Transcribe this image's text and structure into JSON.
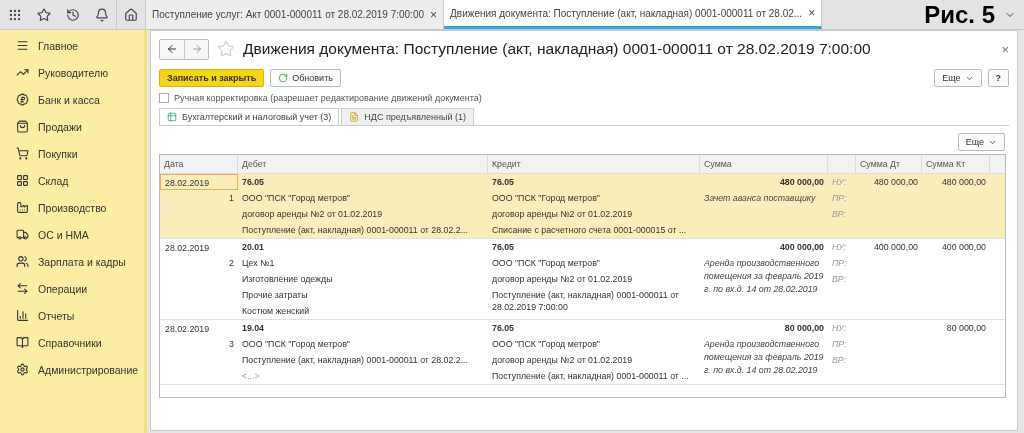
{
  "top_bar": {
    "tabs": [
      {
        "label": "Поступление услуг: Акт 0001-000011 от 28.02.2019 7:00:00",
        "close": "×",
        "selected": false
      },
      {
        "label": "Движения документа: Поступление (акт, накладная) 0001-000011 от 28.02...",
        "close": "×",
        "selected": true
      }
    ],
    "figure_label": "Рис. 5"
  },
  "sidebar": {
    "items": [
      {
        "label": "Главное"
      },
      {
        "label": "Руководителю"
      },
      {
        "label": "Банк и касса"
      },
      {
        "label": "Продажи"
      },
      {
        "label": "Покупки"
      },
      {
        "label": "Склад"
      },
      {
        "label": "Производство"
      },
      {
        "label": "ОС и НМА"
      },
      {
        "label": "Зарплата и кадры"
      },
      {
        "label": "Операции"
      },
      {
        "label": "Отчеты"
      },
      {
        "label": "Справочники"
      },
      {
        "label": "Администрирование"
      }
    ]
  },
  "document": {
    "title": "Движения документа: Поступление (акт, накладная) 0001-000011 от 28.02.2019 7:00:00",
    "close": "×",
    "save_button": "Записать и закрыть",
    "refresh_button": "Обновить",
    "more_button": "Еще",
    "help_button": "?",
    "manual_edit": {
      "label": "Ручная корректировка (разрешает редактирование движений документа)",
      "checked": false
    },
    "tabs": [
      {
        "label": "Бухгалтерский и налоговый учет (3)",
        "selected": true
      },
      {
        "label": "НДС предъявленный (1)",
        "selected": false
      }
    ],
    "table": {
      "more_button": "Еще",
      "columns": [
        "Дата",
        "Дебет",
        "Кредит",
        "Сумма",
        "Сумма Дт",
        "Сумма Кт"
      ],
      "rows": [
        {
          "selected": true,
          "date": "28.02.2019",
          "number": "1",
          "debit": [
            "76.05",
            "ООО \"ПСК \"Город метров\"",
            "договор аренды №2 от 01.02.2019",
            "Поступление (акт, накладная) 0001-000011 от 28.02.2..."
          ],
          "credit": [
            "76.05",
            "ООО \"ПСК \"Город метров\"",
            "договор аренды №2 от 01.02.2019",
            "Списание с расчетного счета 0001-000015 от ..."
          ],
          "sum": "480 000,00",
          "comment": "Зачет аванса поставщику",
          "tax_labels": [
            "НУ:",
            "ПР:",
            "ВР:"
          ],
          "sum_dt": "480 000,00",
          "sum_kt": "480 000,00"
        },
        {
          "selected": false,
          "date": "28.02.2019",
          "number": "2",
          "debit": [
            "20.01",
            "Цех №1",
            "Изготовление одежды",
            "Прочие затраты",
            "Костюм женский"
          ],
          "credit": [
            "76.05",
            "ООО \"ПСК \"Город метров\"",
            "договор аренды №2 от 01.02.2019",
            "Поступление (акт, накладная) 0001-000011 от 28.02.2019 7:00:00"
          ],
          "sum": "400 000,00",
          "comment": "Аренда производственного помещения за февраль 2019 г. по вх.д. 14 от 28.02.2019",
          "tax_labels": [
            "НУ:",
            "ПР:",
            "ВР:"
          ],
          "sum_dt": "400 000,00",
          "sum_kt": "400 000,00"
        },
        {
          "selected": false,
          "date": "28.02.2019",
          "number": "3",
          "debit": [
            "19.04",
            "ООО \"ПСК \"Город метров\"",
            "Поступление (акт, накладная) 0001-000011 от 28.02.2...",
            "<...>"
          ],
          "credit": [
            "76.05",
            "ООО \"ПСК \"Город метров\"",
            "договор аренды №2 от 01.02.2019",
            "Поступление (акт, накладная) 0001-000011 от ..."
          ],
          "sum": "80 000,00",
          "comment": "Аренда производственного помещения за февраль 2019 г. по вх.д. 14 от 28.02.2019",
          "tax_labels": [
            "НУ:",
            "ПР:",
            "ВР:"
          ],
          "sum_kt": "80 000,00"
        }
      ]
    }
  }
}
